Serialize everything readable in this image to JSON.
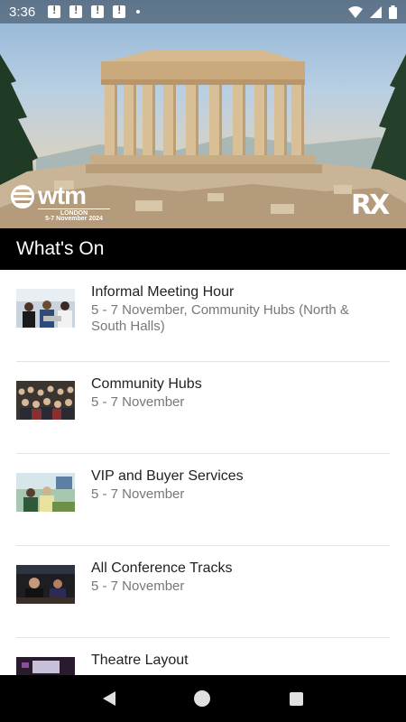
{
  "status_bar": {
    "time": "3:36",
    "notification_icons": [
      "alert-icon",
      "alert-icon",
      "alert-icon",
      "alert-icon"
    ]
  },
  "hero": {
    "image": "parthenon-banner",
    "wtm_logo": {
      "wordmark": "wtm",
      "city": "LONDON",
      "dates": "5-7 November 2024"
    },
    "partner_logo": "RX"
  },
  "section": {
    "title": "What's On"
  },
  "list": [
    {
      "title": "Informal Meeting Hour",
      "subtitle": "5 - 7 November, Community Hubs (North & South Halls)",
      "thumb": "meeting-photo"
    },
    {
      "title": "Community Hubs",
      "subtitle": "5 - 7 November",
      "thumb": "crowd-photo"
    },
    {
      "title": "VIP and Buyer Services",
      "subtitle": "5 - 7 November",
      "thumb": "lounge-photo"
    },
    {
      "title": "All Conference Tracks",
      "subtitle": "5 - 7 November",
      "thumb": "panel-photo"
    },
    {
      "title": "Theatre Layout",
      "subtitle": "",
      "thumb": "theatre-photo"
    }
  ],
  "colors": {
    "header_bg": "#000000",
    "title_text": "#222222",
    "subtitle_text": "#777777"
  }
}
